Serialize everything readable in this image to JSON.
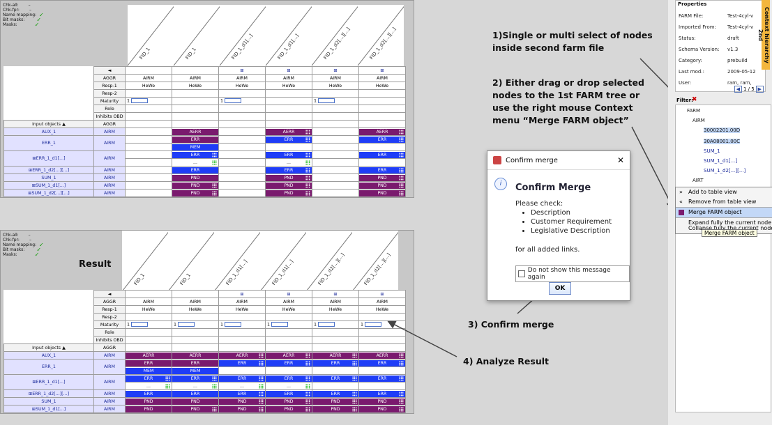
{
  "status": {
    "chk_all": "Chk-all:",
    "chk_all_val": "–",
    "chk_fpr": "Chk-fpr:",
    "chk_fpr_val": "–",
    "name_mapping": "Name mapping:",
    "bit_masks": "Bit masks:",
    "masks": "Masks:"
  },
  "columns": [
    "FID_1",
    "FID_1",
    "FID_1_d1[...]",
    "FID_1_d1[...]",
    "FID_1_d2[...][...]",
    "FID_1_d2[...][...]"
  ],
  "row_labels": {
    "aggr": "AGGR",
    "resp1": "Resp-1",
    "resp2": "Resp-2",
    "maturity": "Maturity",
    "role": "Role",
    "inhibits": "Inhibits OBD",
    "aggr2": "AGGR"
  },
  "nav_arrow": "◄",
  "plus": "⊞",
  "aggr_values": [
    "AIRM",
    "AIRM",
    "AIRM",
    "AIRM",
    "AIRM",
    "AIRM"
  ],
  "resp_values": [
    "HeWe",
    "HeWe",
    "HeWe",
    "HeWe",
    "HeWe",
    "HeWe"
  ],
  "maturity_value": "1",
  "input_objects_header": "Input objects ▲",
  "objects": [
    {
      "name": "AUX_1",
      "aggr": "AIRM"
    },
    {
      "name": "ERR_1",
      "aggr": "AIRM"
    },
    {
      "name": "⊞ERR_1_d1[...]",
      "aggr": "AIRM"
    },
    {
      "name": "⊞ERR_1_d2[...][...]",
      "aggr": "AIRM"
    },
    {
      "name": "SUM_1",
      "aggr": "AIRM"
    },
    {
      "name": "⊞SUM_1_d1[...]",
      "aggr": "AIRM"
    },
    {
      "name": "⊞SUM_1_d2[...][...]",
      "aggr": "AIRM"
    }
  ],
  "cell_labels": {
    "aerr": "AERR",
    "err": "ERR",
    "mem": "MEM",
    "pnd": "PND",
    "dots": "..."
  },
  "annotations": {
    "a1": "1)Single or multi select of nodes inside second farm file",
    "a2": "2) Either drag or drop selected nodes to the 1st FARM tree or use the right mouse Context menu “Merge FARM object”",
    "a3": "3) Confirm merge",
    "a4": "4) Analyze Result",
    "result": "Result"
  },
  "dialog": {
    "title": "Confirm merge",
    "heading": "Confirm Merge",
    "please_check": "Please check:",
    "bullets": [
      "Description",
      "Customer Requirement",
      "Legislative Description"
    ],
    "footer": "for all added links.",
    "checkbox_label": "Do not show this message again",
    "ok": "OK",
    "close": "✕"
  },
  "right_panel": {
    "header": "Properties",
    "props": [
      {
        "k": "FARM File:",
        "v": "Test-4cyl-v"
      },
      {
        "k": "Imported From:",
        "v": "Test-4cyl-v"
      },
      {
        "k": "Status:",
        "v": "draft"
      },
      {
        "k": "Schema Version:",
        "v": "v1.3"
      },
      {
        "k": "Category:",
        "v": "prebuild"
      },
      {
        "k": "Last mod.:",
        "v": "2009-05-12"
      },
      {
        "k": "User:",
        "v": "ram, ram, "
      }
    ],
    "pager": "1 / 5",
    "filter": "Filter:",
    "tree": [
      "FARM",
      "AIRM",
      "30002201.00D",
      "30A08001.00C",
      "SUM_1",
      "SUM_1_d1[...]",
      "SUM_1_d2[...][...]",
      "AIRT"
    ],
    "side_tab": "Context hierarchy 2nd"
  },
  "context_menu": {
    "items": [
      "Add to table view",
      "Remove from table view",
      "Merge FARM object",
      "Expand fully the current node",
      "Collapse fully the current node"
    ],
    "tooltip": "Merge FARM object"
  }
}
